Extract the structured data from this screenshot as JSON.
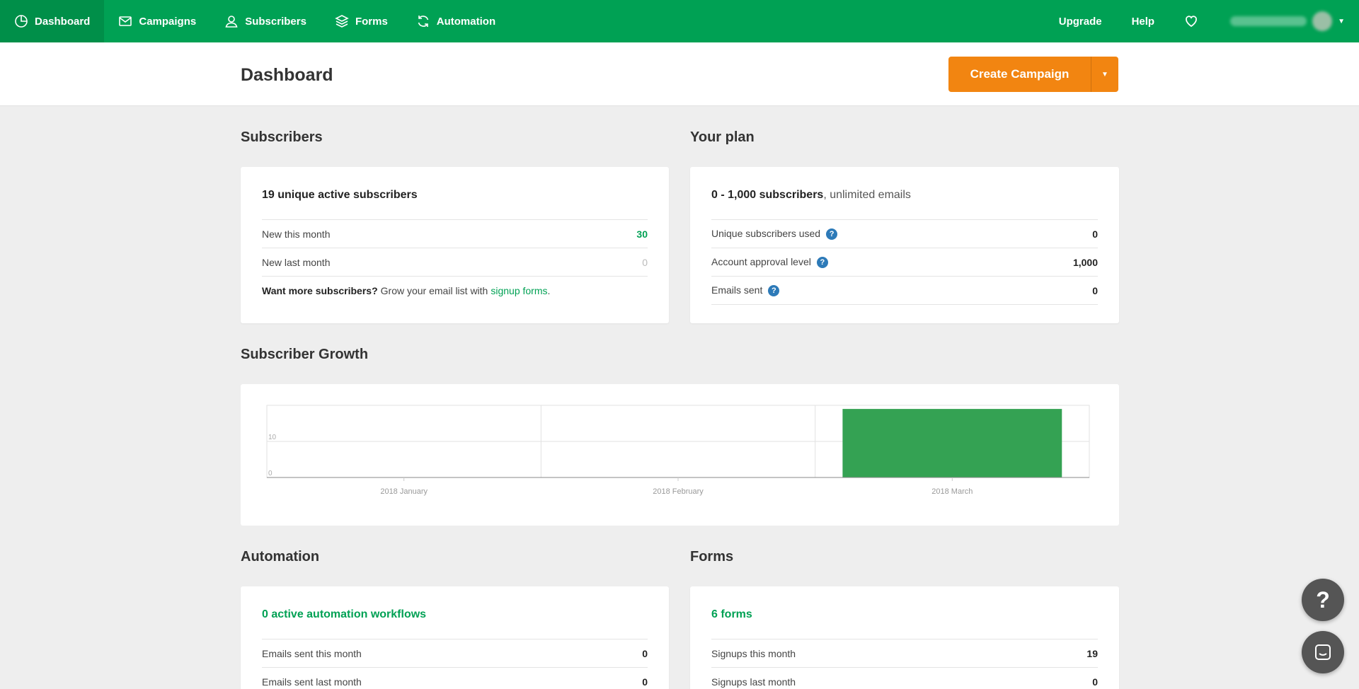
{
  "nav": {
    "items": [
      {
        "label": "Dashboard",
        "icon": "pie-chart-icon",
        "active": true
      },
      {
        "label": "Campaigns",
        "icon": "envelope-icon"
      },
      {
        "label": "Subscribers",
        "icon": "user-icon"
      },
      {
        "label": "Forms",
        "icon": "layers-icon"
      },
      {
        "label": "Automation",
        "icon": "refresh-icon"
      }
    ],
    "upgrade_label": "Upgrade",
    "help_label": "Help",
    "favorites_icon": "heart-icon",
    "brand_color": "#00a154"
  },
  "header": {
    "title": "Dashboard",
    "create_button_label": "Create Campaign",
    "create_button_color": "#f28511"
  },
  "subscribers": {
    "section_title": "Subscribers",
    "headline": "19 unique active subscribers",
    "rows": [
      {
        "label": "New this month",
        "value": "30"
      },
      {
        "label": "New last month",
        "value": "0"
      }
    ],
    "note_bold": "Want more subscribers?",
    "note_text": "Grow your email list with",
    "note_link": "signup forms",
    "note_end": "."
  },
  "plan": {
    "section_title": "Your plan",
    "headline_bold": "0 - 1,000 subscribers",
    "headline_rest": ", unlimited emails",
    "rows": [
      {
        "label": "Unique subscribers used",
        "value": "0"
      },
      {
        "label": "Account approval level",
        "value": "1,000"
      },
      {
        "label": "Emails sent",
        "value": "0"
      }
    ]
  },
  "growth": {
    "section_title": "Subscriber Growth"
  },
  "chart_data": {
    "type": "bar",
    "categories": [
      "2018 January",
      "2018 February",
      "2018 March"
    ],
    "values": [
      0,
      0,
      19
    ],
    "ylim": [
      0,
      20
    ],
    "yticks": [
      0,
      10
    ],
    "grid": true,
    "color": "#34a253"
  },
  "automation": {
    "section_title": "Automation",
    "headline": "0 active automation workflows",
    "rows": [
      {
        "label": "Emails sent this month",
        "value": "0"
      },
      {
        "label": "Emails sent last month",
        "value": "0"
      }
    ]
  },
  "forms": {
    "section_title": "Forms",
    "headline": "6 forms",
    "rows": [
      {
        "label": "Signups this month",
        "value": "19"
      },
      {
        "label": "Signups last month",
        "value": "0"
      }
    ]
  },
  "floating": {
    "help_label": "?",
    "help_icon": "question-icon",
    "chat_icon": "chat-icon"
  }
}
